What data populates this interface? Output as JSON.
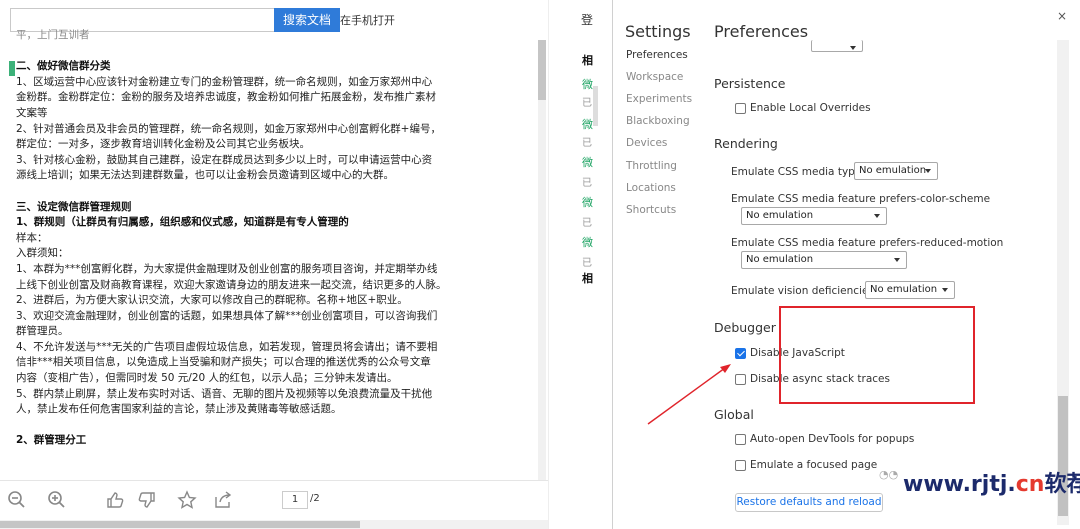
{
  "doc": {
    "search_button": "搜索文档",
    "open_on_phone": "在手机打开",
    "lines": [
      {
        "t": "平，上门互训者",
        "cls": "faded"
      },
      {
        "t": "",
        "cls": "gap"
      },
      {
        "t": "二、做好微信群分类",
        "cls": "h"
      },
      {
        "t": "1、区域运营中心应该针对金粉建立专门的金粉管理群，统一命名规则，如金万家郑州中心",
        "cls": ""
      },
      {
        "t": "金粉群。金粉群定位：金粉的服务及培养忠诚度，教金粉如何推广拓展金粉，发布推广素材",
        "cls": ""
      },
      {
        "t": "文案等",
        "cls": ""
      },
      {
        "t": "2、针对普通会员及非会员的管理群，统一命名规则，如金万家郑州中心创富孵化群+编号，",
        "cls": ""
      },
      {
        "t": "群定位：一对多，逐步教育培训转化金粉及公司其它业务板块。",
        "cls": ""
      },
      {
        "t": "3、针对核心金粉，鼓励其自己建群，设定在群成员达到多少以上时，可以申请运营中心资",
        "cls": ""
      },
      {
        "t": "源线上培训；如果无法达到建群数量，也可以让金粉会员邀请到区域中心的大群。",
        "cls": ""
      },
      {
        "t": "",
        "cls": "gap"
      },
      {
        "t": "三、设定微信群管理规则",
        "cls": "h"
      },
      {
        "t": "1、群规则（让群员有归属感，组织感和仪式感，知道群是有专人管理的",
        "cls": "h"
      },
      {
        "t": "样本：",
        "cls": ""
      },
      {
        "t": "入群须知：",
        "cls": ""
      },
      {
        "t": "1、本群为***创富孵化群，为大家提供金融理财及创业创富的服务项目咨询，并定期举办线",
        "cls": ""
      },
      {
        "t": "上线下创业创富及财商教育课程，欢迎大家邀请身边的朋友进来一起交流，结识更多的人脉。",
        "cls": ""
      },
      {
        "t": "2、进群后，为方便大家认识交流，大家可以修改自己的群昵称。名称+地区+职业。",
        "cls": ""
      },
      {
        "t": "3、欢迎交流金融理财，创业创富的话题，如果想具体了解***创业创富项目，可以咨询我们",
        "cls": ""
      },
      {
        "t": "群管理员。",
        "cls": ""
      },
      {
        "t": "4、不允许发送与***无关的广告项目虚假垃圾信息，如若发现，管理员将会请出；请不要相",
        "cls": ""
      },
      {
        "t": "信非***相关项目信息，以免造成上当受骗和财产损失；可以合理的推送优秀的公众号文章",
        "cls": ""
      },
      {
        "t": "内容（变相广告），但需同时发 50 元/20 人的红包，以示人品；三分钟未发请出。",
        "cls": ""
      },
      {
        "t": "5、群内禁止刷屏，禁止发布实时对话、语音、无聊的图片及视频等以免浪费流量及干扰他",
        "cls": ""
      },
      {
        "t": "人，禁止发布任何危害国家利益的言论，禁止涉及黄赌毒等敏感话题。",
        "cls": ""
      },
      {
        "t": "",
        "cls": "gap"
      },
      {
        "t": "2、群管理分工",
        "cls": "h"
      }
    ],
    "page_current": "1",
    "page_total": "/2"
  },
  "side": {
    "login": "登",
    "items": [
      {
        "t": "相",
        "cls": "t"
      },
      {
        "t": "微",
        "cls": "g"
      },
      {
        "t": "已",
        "cls": "s"
      },
      {
        "t": "微",
        "cls": "g"
      },
      {
        "t": "已",
        "cls": "s"
      },
      {
        "t": "微",
        "cls": "g"
      },
      {
        "t": "已",
        "cls": "s"
      },
      {
        "t": "微",
        "cls": "g"
      },
      {
        "t": "已",
        "cls": "s"
      },
      {
        "t": "微",
        "cls": "g"
      },
      {
        "t": "已",
        "cls": "s"
      },
      {
        "t": "相",
        "cls": "t"
      }
    ]
  },
  "devtools": {
    "settings_title": "Settings",
    "nav": [
      {
        "label": "Preferences",
        "active": true
      },
      {
        "label": "Workspace",
        "active": false
      },
      {
        "label": "Experiments",
        "active": false
      },
      {
        "label": "Blackboxing",
        "active": false
      },
      {
        "label": "Devices",
        "active": false
      },
      {
        "label": "Throttling",
        "active": false
      },
      {
        "label": "Locations",
        "active": false
      },
      {
        "label": "Shortcuts",
        "active": false
      }
    ],
    "preferences_title": "Preferences",
    "close": "×",
    "persistence": {
      "title": "Persistence",
      "enable_local_overrides": "Enable Local Overrides"
    },
    "rendering": {
      "title": "Rendering",
      "css_media_type_label": "Emulate CSS media type",
      "css_media_type_value": "No emulation",
      "color_scheme_label": "Emulate CSS media feature prefers-color-scheme",
      "color_scheme_value": "No emulation",
      "reduced_motion_label": "Emulate CSS media feature prefers-reduced-motion",
      "reduced_motion_value": "No emulation",
      "vision_label": "Emulate vision deficiencies",
      "vision_value": "No emulation"
    },
    "debugger": {
      "title": "Debugger",
      "disable_js": "Disable JavaScript",
      "disable_js_checked": true,
      "disable_async": "Disable async stack traces",
      "disable_async_checked": false
    },
    "global": {
      "title": "Global",
      "auto_open": "Auto-open DevTools for popups",
      "emulate_focus": "Emulate a focused page"
    },
    "restore_button": "Restore defaults and reload",
    "watermark_prefix": "www.rjtj.",
    "watermark_cn": "cn",
    "watermark_suffix": "软荐网"
  },
  "colors": {
    "accent": "#1a73e8",
    "highlight_box": "#e0242b",
    "search_button": "#2f7bd9",
    "side_link": "#1aa260"
  }
}
